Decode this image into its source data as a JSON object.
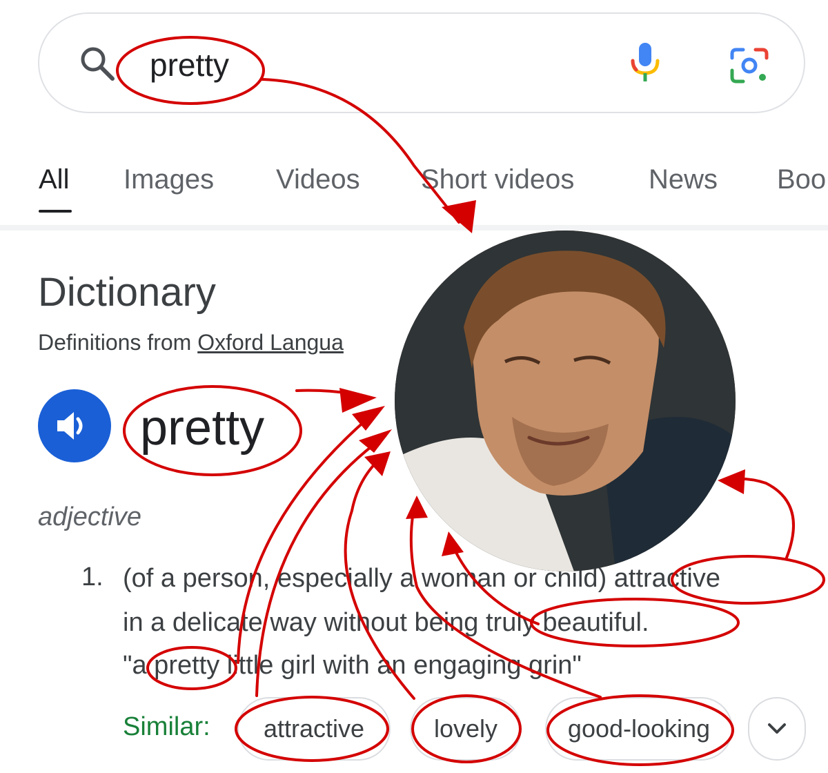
{
  "search": {
    "query": "pretty"
  },
  "tabs": [
    {
      "label": "All",
      "active": true
    },
    {
      "label": "Images"
    },
    {
      "label": "Videos"
    },
    {
      "label": "Short videos"
    },
    {
      "label": "News"
    },
    {
      "label": "Boo"
    }
  ],
  "dictionary": {
    "title": "Dictionary",
    "source_prefix": "Definitions from",
    "source_link": "Oxford Langua",
    "word": "pretty",
    "part_of_speech": "adjective",
    "definition": {
      "number": "1.",
      "line1": "(of a person, especially a woman or child) attractive",
      "line2": "in a delicate way without being truly beautiful.",
      "example": "\"a pretty little girl with an engaging grin\""
    },
    "similar_label": "Similar:",
    "similar": [
      "attractive",
      "lovely",
      "good-looking"
    ]
  },
  "annotation": {
    "ink_color": "#d40000"
  },
  "colors": {
    "link_green": "#188038",
    "speaker_blue": "#1a5fd6",
    "tab_gray": "#5f6368"
  },
  "icons": [
    "search-icon",
    "mic-icon",
    "google-lens-icon",
    "speaker-icon",
    "chevron-down-icon"
  ]
}
